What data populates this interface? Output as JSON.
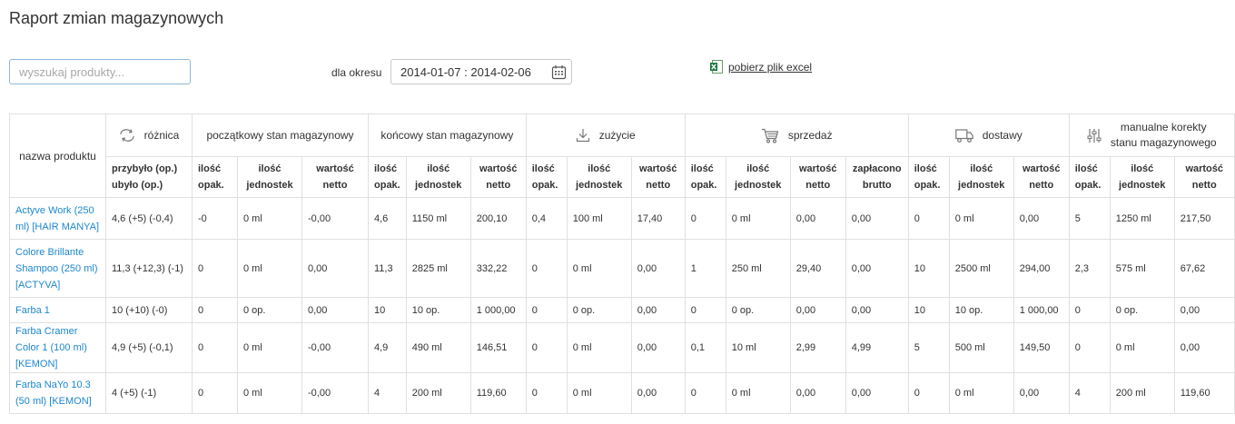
{
  "title": "Raport zmian magazynowych",
  "search": {
    "placeholder": "wyszukaj produkty..."
  },
  "period": {
    "label": "dla okresu",
    "value": "2014-01-07 : 2014-02-06"
  },
  "excel": {
    "label": "pobierz plik excel"
  },
  "table": {
    "name_header": "nazwa produktu",
    "diff": {
      "title": "różnica",
      "sub1": "przybyło (op.)",
      "sub2": "ubyło (op.)"
    },
    "groups": {
      "start": "początkowy stan magazynowy",
      "end": "końcowy stan magazynowy",
      "usage": "zużycie",
      "sales": "sprzedaż",
      "deliveries": "dostawy",
      "manual1": "manualne korekty",
      "manual2": "stanu magazynowego"
    },
    "sub": {
      "pack1": "ilość",
      "pack2": "opak.",
      "units1": "ilość",
      "units2": "jednostek",
      "net1": "wartość",
      "net2": "netto",
      "paid1": "zapłacono",
      "paid2": "brutto"
    },
    "rows": [
      {
        "name": "Actyve Work (250 ml) [HAIR MANYA]",
        "diff": "4,6 (+5) (-0,4)",
        "start": [
          "-0",
          "0 ml",
          "-0,00"
        ],
        "end": [
          "4,6",
          "1150 ml",
          "200,10"
        ],
        "usage": [
          "0,4",
          "100 ml",
          "17,40"
        ],
        "sales": [
          "0",
          "0 ml",
          "0,00",
          "0,00"
        ],
        "deliveries": [
          "0",
          "0 ml",
          "0,00"
        ],
        "manual": [
          "5",
          "1250 ml",
          "217,50"
        ]
      },
      {
        "name": "Colore Brillante Shampoo (250 ml) [ACTYVA]",
        "diff": "11,3 (+12,3) (-1)",
        "start": [
          "0",
          "0 ml",
          "0,00"
        ],
        "end": [
          "11,3",
          "2825 ml",
          "332,22"
        ],
        "usage": [
          "0",
          "0 ml",
          "0,00"
        ],
        "sales": [
          "1",
          "250 ml",
          "29,40",
          "0,00"
        ],
        "deliveries": [
          "10",
          "2500 ml",
          "294,00"
        ],
        "manual": [
          "2,3",
          "575 ml",
          "67,62"
        ]
      },
      {
        "name": "Farba 1",
        "diff": "10 (+10) (-0)",
        "start": [
          "0",
          "0 op.",
          "0,00"
        ],
        "end": [
          "10",
          "10 op.",
          "1 000,00"
        ],
        "usage": [
          "0",
          "0 op.",
          "0,00"
        ],
        "sales": [
          "0",
          "0 op.",
          "0,00",
          "0,00"
        ],
        "deliveries": [
          "10",
          "10 op.",
          "1 000,00"
        ],
        "manual": [
          "0",
          "0 op.",
          "0,00"
        ]
      },
      {
        "name": "Farba Cramer Color 1 (100 ml) [KEMON]",
        "diff": "4,9 (+5) (-0,1)",
        "start": [
          "0",
          "0 ml",
          "-0,00"
        ],
        "end": [
          "4,9",
          "490 ml",
          "146,51"
        ],
        "usage": [
          "0",
          "0 ml",
          "0,00"
        ],
        "sales": [
          "0,1",
          "10 ml",
          "2,99",
          "4,99"
        ],
        "deliveries": [
          "5",
          "500 ml",
          "149,50"
        ],
        "manual": [
          "0",
          "0 ml",
          "0,00"
        ]
      },
      {
        "name": "Farba NaYo 10.3 (50 ml) [KEMON]",
        "diff": "4 (+5) (-1)",
        "start": [
          "0",
          "0 ml",
          "-0,00"
        ],
        "end": [
          "4",
          "200 ml",
          "119,60"
        ],
        "usage": [
          "0",
          "0 ml",
          "0,00"
        ],
        "sales": [
          "0",
          "0 ml",
          "0,00",
          "0,00"
        ],
        "deliveries": [
          "0",
          "0 ml",
          "0,00"
        ],
        "manual": [
          "4",
          "200 ml",
          "119,60"
        ]
      }
    ]
  },
  "colors": {
    "link": "#1d87d0",
    "border": "#e0e0e0",
    "input_border": "#8fb8d8",
    "excel_green": "#1f7a3f"
  },
  "icons": {
    "diff": "swap-arrows-icon",
    "usage": "download-arrow-icon",
    "sales": "cart-icon",
    "deliveries": "truck-icon",
    "manual": "sliders-icon",
    "date": "calendar-icon",
    "excel": "excel-icon"
  }
}
